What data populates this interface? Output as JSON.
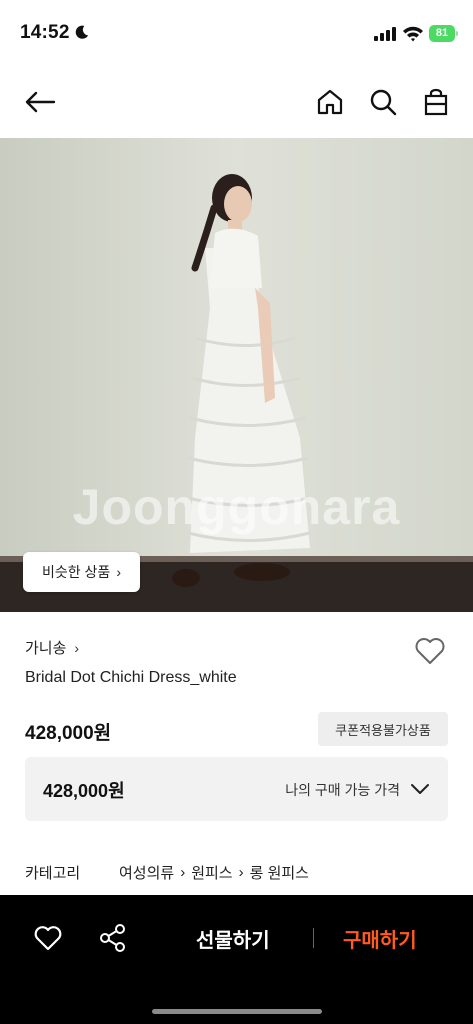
{
  "status_bar": {
    "time": "14:52",
    "battery": "81"
  },
  "nav": {
    "back_icon": "back-arrow-icon",
    "home_icon": "home-icon",
    "search_icon": "search-icon",
    "cart_icon": "shopping-bag-icon"
  },
  "hero": {
    "watermark": "Joonggonara",
    "similar_button": "비슷한 상품"
  },
  "product": {
    "brand": "가니송",
    "name": "Bridal Dot Chichi Dress_white",
    "price": "428,000원",
    "coupon_badge": "쿠폰적용불가상품",
    "my_price_value": "428,000원",
    "my_price_label": "나의 구매 가능 가격"
  },
  "category": {
    "label": "카테고리",
    "path": [
      "여성의류",
      "원피스",
      "롱 원피스"
    ]
  },
  "bottom_bar": {
    "gift_label": "선물하기",
    "buy_label": "구매하기"
  },
  "colors": {
    "accent": "#ff5a1f",
    "bottom_bar_bg": "#000000",
    "battery": "#4cd964"
  }
}
